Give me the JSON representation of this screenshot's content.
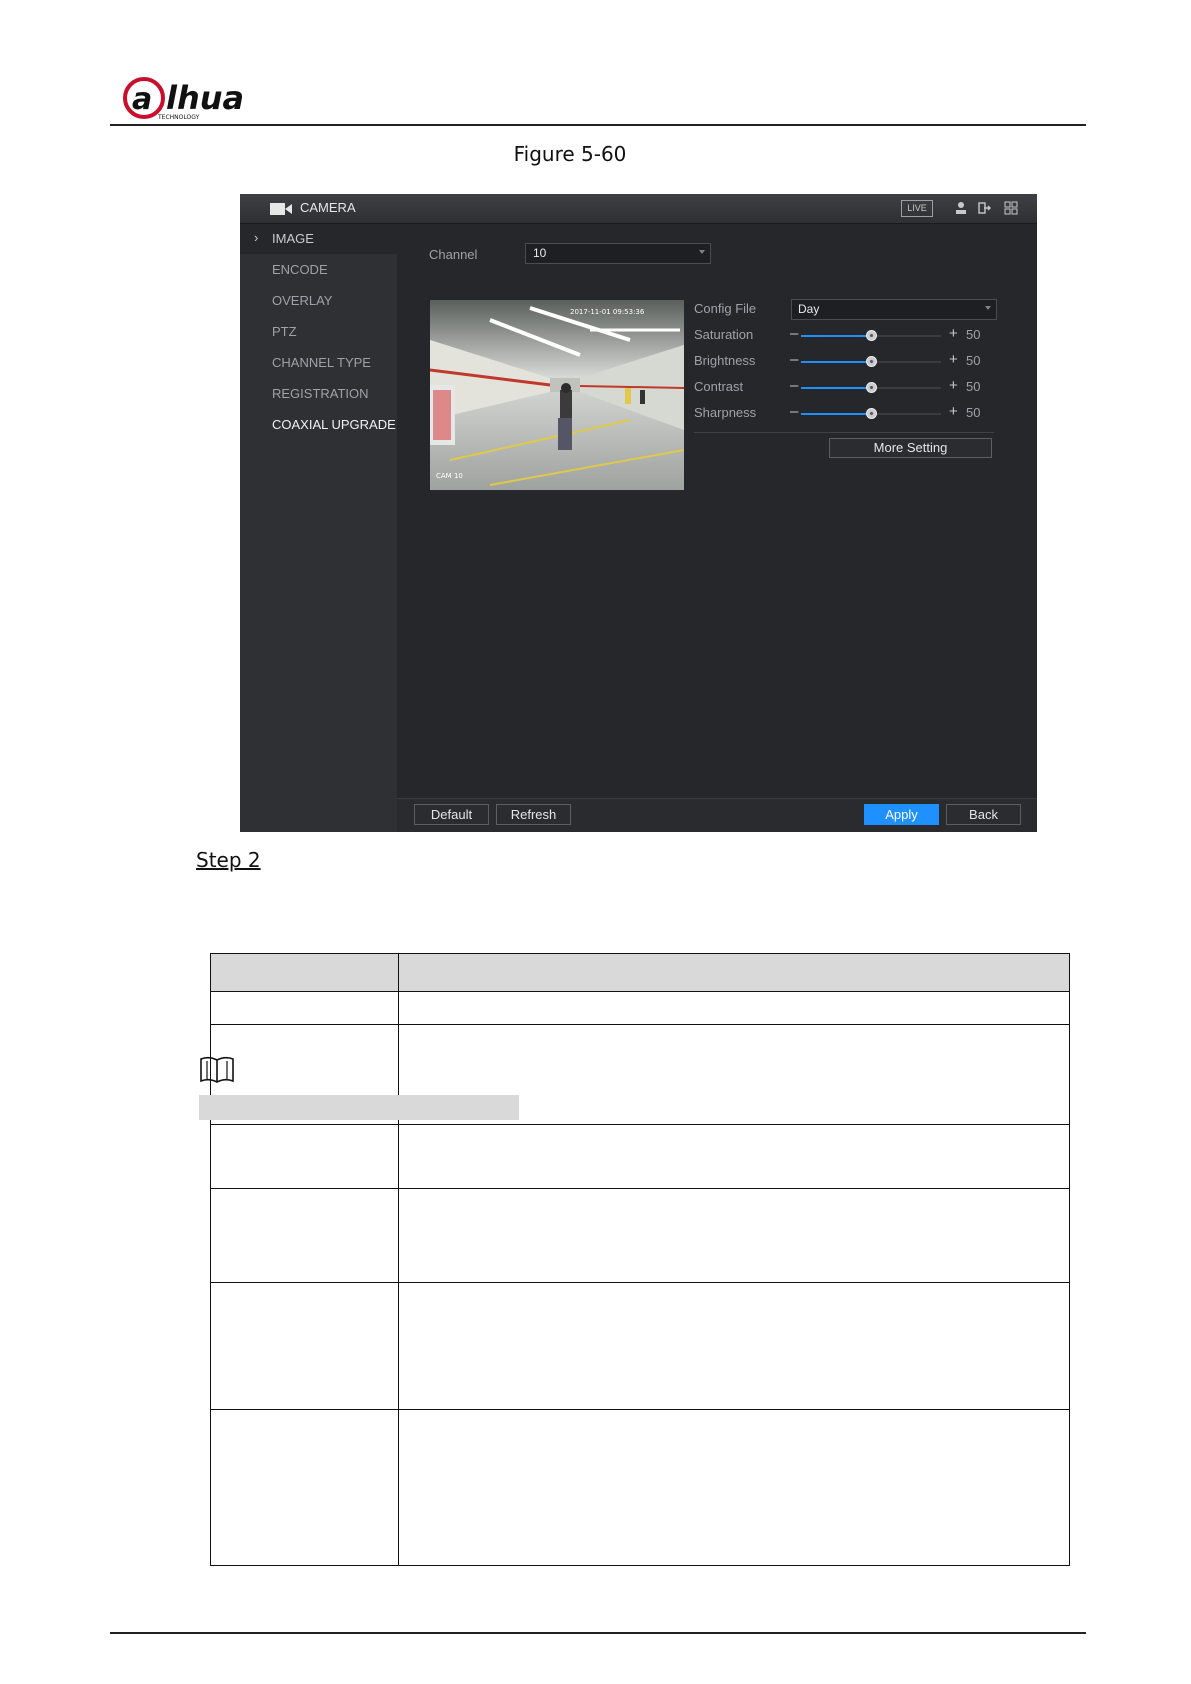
{
  "header": {
    "logo_text": "alhua",
    "logo_sub": "TECHNOLOGY",
    "figure_caption": "Figure 5-60"
  },
  "ui": {
    "title": "CAMERA",
    "live_badge": "LIVE",
    "sidebar": [
      {
        "label": "IMAGE",
        "active": true
      },
      {
        "label": "ENCODE"
      },
      {
        "label": "OVERLAY"
      },
      {
        "label": "PTZ"
      },
      {
        "label": "CHANNEL TYPE"
      },
      {
        "label": "REGISTRATION"
      },
      {
        "label": "COAXIAL UPGRADE"
      }
    ],
    "channel_label": "Channel",
    "channel_value": "10",
    "preview_timestamp": "2017-11-01 09:53:36",
    "preview_label": "CAM 10",
    "config_file_label": "Config File",
    "config_file_value": "Day",
    "sliders": [
      {
        "label": "Saturation",
        "value": 50,
        "max": 100
      },
      {
        "label": "Brightness",
        "value": 50,
        "max": 100
      },
      {
        "label": "Contrast",
        "value": 50,
        "max": 100
      },
      {
        "label": "Sharpness",
        "value": 50,
        "max": 100
      }
    ],
    "more_setting": "More Setting",
    "buttons": {
      "default": "Default",
      "refresh": "Refresh",
      "apply": "Apply",
      "back": "Back"
    },
    "colors": {
      "accent": "#1e90ff"
    }
  },
  "doc": {
    "step": "Step 2"
  }
}
